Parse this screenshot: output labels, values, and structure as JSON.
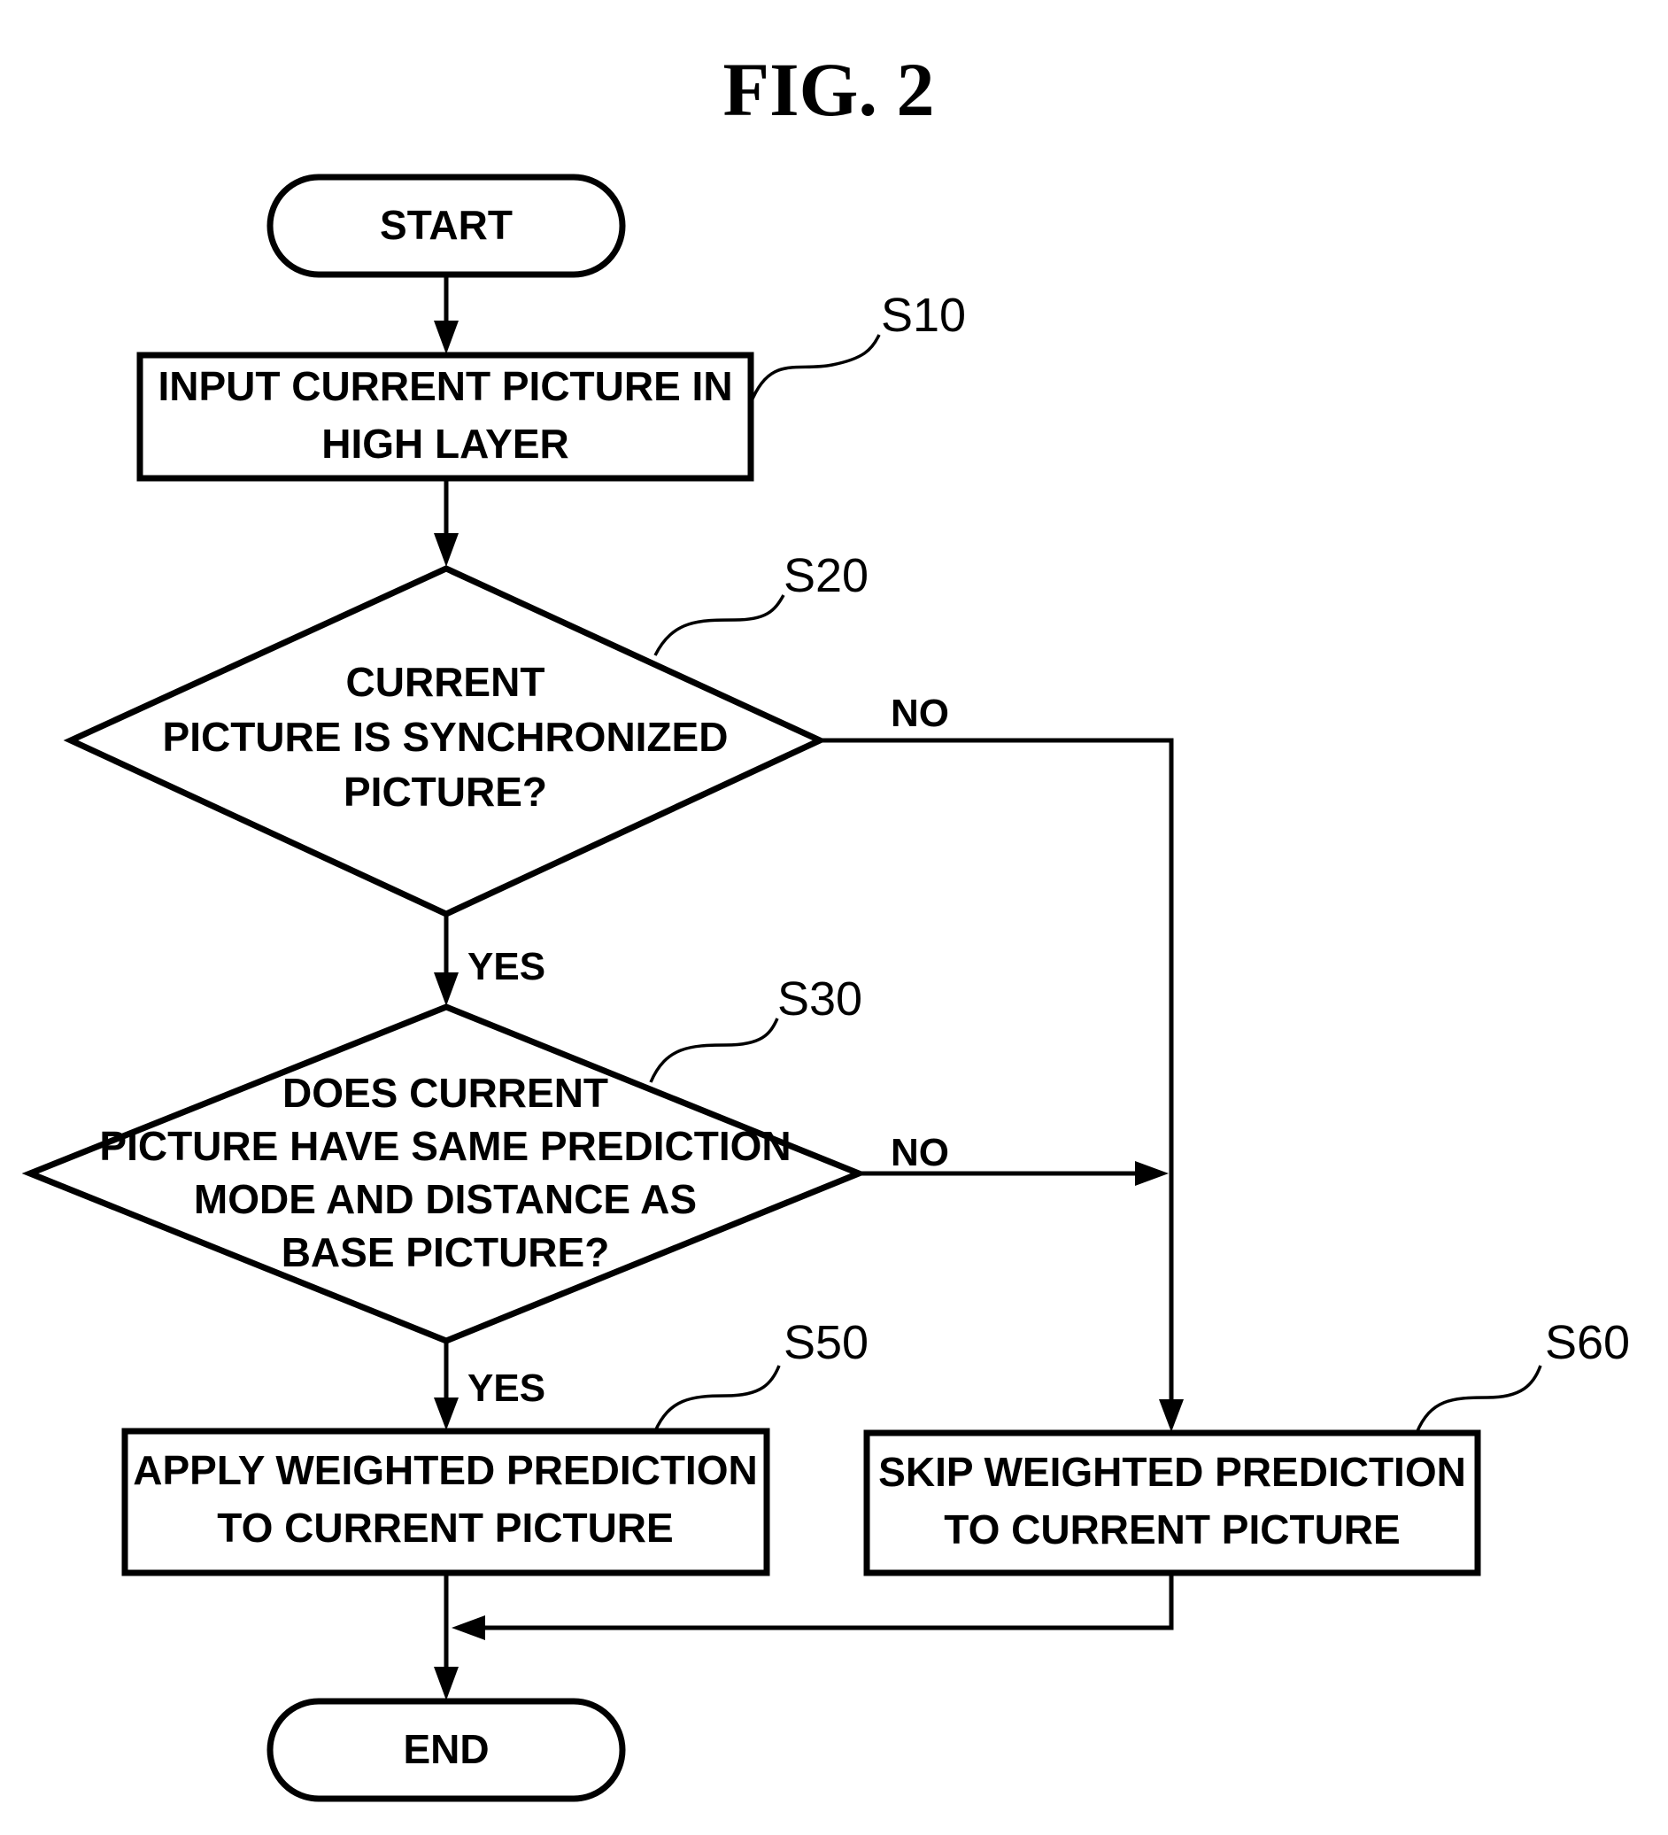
{
  "figure": {
    "title": "FIG. 2"
  },
  "nodes": {
    "start": {
      "text": "START"
    },
    "s10": {
      "step": "S10",
      "lines": [
        "INPUT CURRENT PICTURE IN",
        "HIGH LAYER"
      ]
    },
    "s20": {
      "step": "S20",
      "lines": [
        "CURRENT",
        "PICTURE IS SYNCHRONIZED",
        "PICTURE?"
      ]
    },
    "s30": {
      "step": "S30",
      "lines": [
        "DOES CURRENT",
        "PICTURE HAVE SAME PREDICTION",
        "MODE AND DISTANCE AS",
        "BASE PICTURE?"
      ]
    },
    "s50": {
      "step": "S50",
      "lines": [
        "APPLY WEIGHTED PREDICTION",
        "TO CURRENT PICTURE"
      ]
    },
    "s60": {
      "step": "S60",
      "lines": [
        "SKIP WEIGHTED PREDICTION",
        "TO CURRENT PICTURE"
      ]
    },
    "end": {
      "text": "END"
    }
  },
  "edges": {
    "s20_no": "NO",
    "s20_yes": "YES",
    "s30_no": "NO",
    "s30_yes": "YES"
  },
  "colors": {
    "ink": "#000000",
    "paper": "#ffffff"
  }
}
